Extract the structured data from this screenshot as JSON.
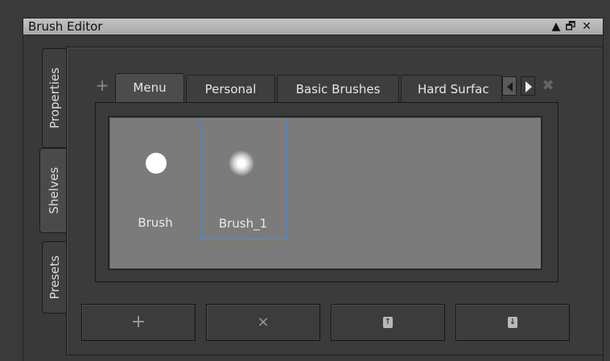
{
  "window": {
    "title": "Brush Editor",
    "controls": [
      "maximize-icon",
      "restore-icon",
      "close-icon"
    ]
  },
  "side_tabs": [
    {
      "label": "Properties",
      "active": false
    },
    {
      "label": "Shelves",
      "active": true
    },
    {
      "label": "Presets",
      "active": false
    }
  ],
  "shelf_tabs": [
    {
      "label": "Menu",
      "active": true
    },
    {
      "label": "Personal",
      "active": false
    },
    {
      "label": "Basic Brushes",
      "active": false
    },
    {
      "label": "Hard Surfac",
      "active": false
    }
  ],
  "tab_bar": {
    "add_label": "+",
    "close_label": "✖"
  },
  "brushes": [
    {
      "label": "Brush",
      "icon": "hard-brush-icon",
      "selected": false
    },
    {
      "label": "Brush_1",
      "icon": "soft-brush-icon",
      "selected": true
    }
  ],
  "bottom_buttons": [
    {
      "label": "+",
      "icon": "add-icon"
    },
    {
      "label": "×",
      "icon": "delete-icon"
    },
    {
      "icon": "upload-icon"
    },
    {
      "icon": "download-icon"
    }
  ],
  "colors": {
    "selection": "#3d8ef0",
    "background": "#3a3a3a",
    "brush_area": "#7b7b7b",
    "title_bar": "#b5b5b5"
  }
}
